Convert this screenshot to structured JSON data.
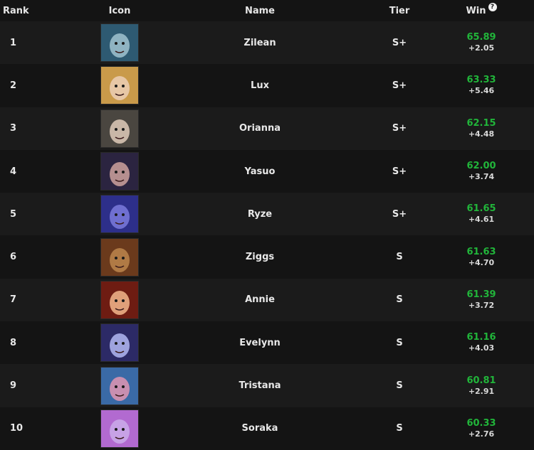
{
  "header": {
    "rank": "Rank",
    "icon": "Icon",
    "name": "Name",
    "tier": "Tier",
    "win": "Win"
  },
  "rows": [
    {
      "rank": "1",
      "name": "Zilean",
      "tier": "S+",
      "win": "65.89",
      "delta": "+2.05",
      "icon": "zilean-portrait",
      "bg": "#2e5a72",
      "face": "#8fb3c2"
    },
    {
      "rank": "2",
      "name": "Lux",
      "tier": "S+",
      "win": "63.33",
      "delta": "+5.46",
      "icon": "lux-portrait",
      "bg": "#c99a4a",
      "face": "#e7c7a6"
    },
    {
      "rank": "3",
      "name": "Orianna",
      "tier": "S+",
      "win": "62.15",
      "delta": "+4.48",
      "icon": "orianna-portrait",
      "bg": "#4a4640",
      "face": "#c9b7a7"
    },
    {
      "rank": "4",
      "name": "Yasuo",
      "tier": "S+",
      "win": "62.00",
      "delta": "+3.74",
      "icon": "yasuo-portrait",
      "bg": "#2b2440",
      "face": "#b58f8f"
    },
    {
      "rank": "5",
      "name": "Ryze",
      "tier": "S+",
      "win": "61.65",
      "delta": "+4.61",
      "icon": "ryze-portrait",
      "bg": "#2d2f8a",
      "face": "#6f6fd0"
    },
    {
      "rank": "6",
      "name": "Ziggs",
      "tier": "S",
      "win": "61.63",
      "delta": "+4.70",
      "icon": "ziggs-portrait",
      "bg": "#6b3a1c",
      "face": "#b07a45"
    },
    {
      "rank": "7",
      "name": "Annie",
      "tier": "S",
      "win": "61.39",
      "delta": "+3.72",
      "icon": "annie-portrait",
      "bg": "#6e1c12",
      "face": "#e0a07a"
    },
    {
      "rank": "8",
      "name": "Evelynn",
      "tier": "S",
      "win": "61.16",
      "delta": "+4.03",
      "icon": "evelynn-portrait",
      "bg": "#2c2a66",
      "face": "#9ea3de"
    },
    {
      "rank": "9",
      "name": "Tristana",
      "tier": "S",
      "win": "60.81",
      "delta": "+2.91",
      "icon": "tristana-portrait",
      "bg": "#3a6aa6",
      "face": "#c88fb0"
    },
    {
      "rank": "10",
      "name": "Soraka",
      "tier": "S",
      "win": "60.33",
      "delta": "+2.76",
      "icon": "soraka-portrait",
      "bg": "#b26ad0",
      "face": "#c7a2e6"
    }
  ]
}
